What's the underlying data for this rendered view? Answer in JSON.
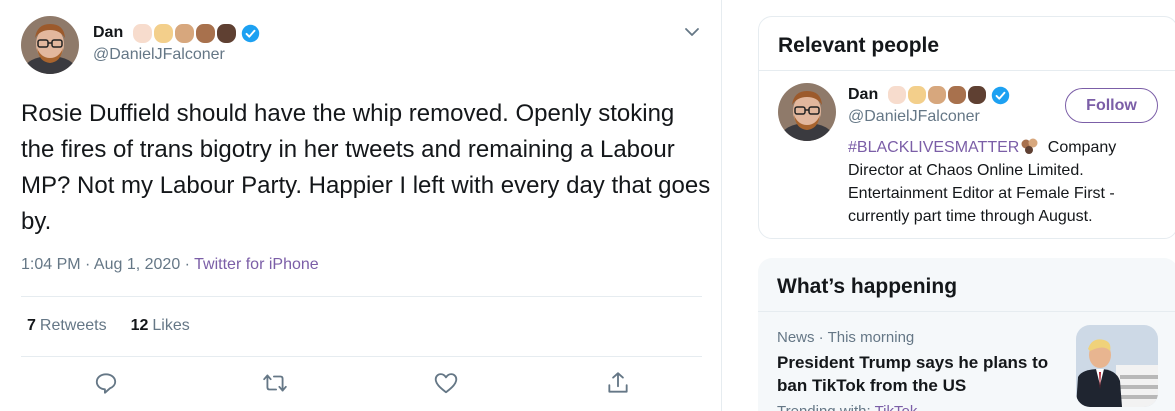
{
  "tweet": {
    "author_name": "Dan",
    "author_handle": "@DanielJFalconer",
    "text": "Rosie Duffield should have the whip removed. Openly stoking the fires of trans bigotry in her tweets and remaining a Labour MP? Not my Labour Party. Happier I left with every day that goes by.",
    "time": "1:04 PM · Aug 1, 2020 · ",
    "source": "Twitter for iPhone",
    "retweets_count": "7",
    "retweets_label": "Retweets",
    "likes_count": "12",
    "likes_label": "Likes"
  },
  "relevant_people": {
    "title": "Relevant people",
    "person": {
      "name": "Dan",
      "handle": "@DanielJFalconer",
      "follow_label": "Follow",
      "bio_tag": "#BLACKLIVESMATTER",
      "bio_text": " Company Director at Chaos Online Limited. Entertainment Editor at Female First - currently part time through August."
    }
  },
  "whats_happening": {
    "title": "What’s happening",
    "news_meta": "News · This morning",
    "headline": "President Trump says he plans to ban TikTok from the US",
    "trending_prefix": "Trending with: ",
    "trending_link": "TikTok"
  },
  "colors": {
    "accent": "#7b5ea7",
    "verified": "#1da1f2",
    "muted": "#657786",
    "skin_tones": [
      "#f7dccd",
      "#f3cf8b",
      "#d7a77d",
      "#a8714d",
      "#5f4032"
    ]
  },
  "icons": [
    "chevron-down-icon",
    "verified-badge-icon",
    "reply-icon",
    "retweet-icon",
    "like-icon",
    "share-icon",
    "raised-fist-emoji"
  ]
}
